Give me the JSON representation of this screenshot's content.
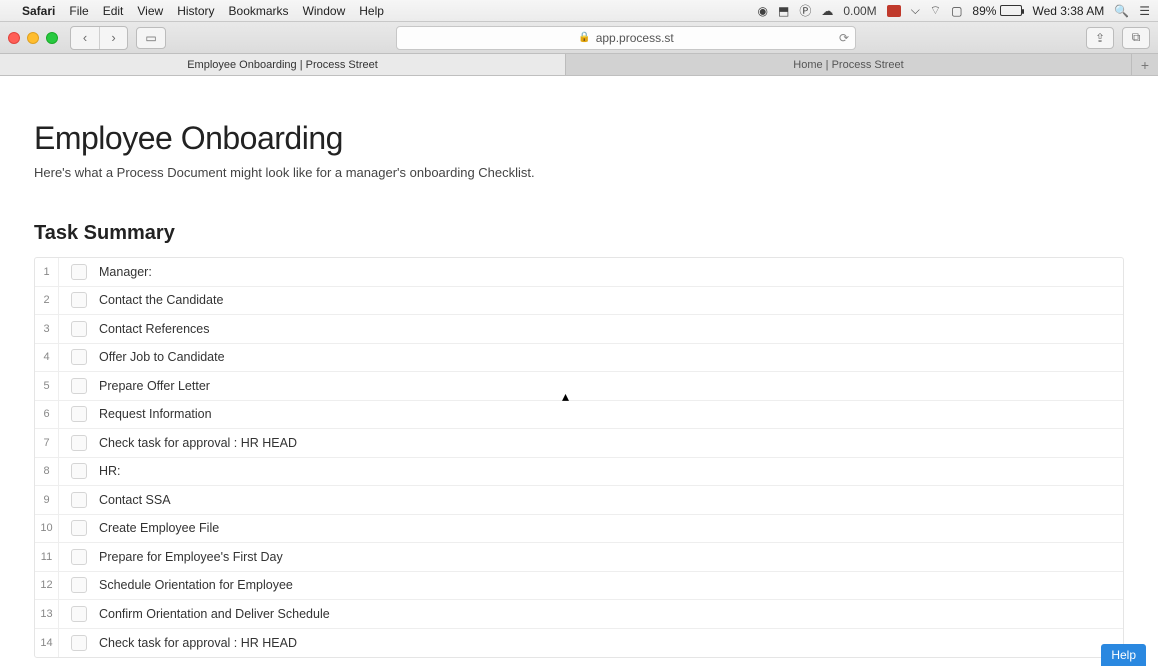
{
  "menubar": {
    "apple": "",
    "app": "Safari",
    "items": [
      "File",
      "Edit",
      "View",
      "History",
      "Bookmarks",
      "Window",
      "Help"
    ],
    "status_text": "0.00M",
    "battery_pct": "89%",
    "clock": "Wed 3:38 AM"
  },
  "toolbar": {
    "back": "‹",
    "forward": "›",
    "sidebar": "▭",
    "url": "app.process.st",
    "reload": "⟳",
    "share": "⇪",
    "tabs_icon": "⧉"
  },
  "tabs": [
    {
      "label": "Employee Onboarding | Process Street",
      "active": true
    },
    {
      "label": "Home | Process Street",
      "active": false
    }
  ],
  "tabs_add": "+",
  "page": {
    "title": "Employee Onboarding",
    "subtitle": "Here's what a Process Document might look like for a manager's onboarding Checklist.",
    "section_title": "Task Summary"
  },
  "tasks": [
    {
      "n": "1",
      "label": "Manager:"
    },
    {
      "n": "2",
      "label": "Contact the Candidate"
    },
    {
      "n": "3",
      "label": "Contact References"
    },
    {
      "n": "4",
      "label": "Offer Job to Candidate"
    },
    {
      "n": "5",
      "label": "Prepare Offer Letter"
    },
    {
      "n": "6",
      "label": "Request Information"
    },
    {
      "n": "7",
      "label": "Check task for approval : HR HEAD"
    },
    {
      "n": "8",
      "label": "HR:"
    },
    {
      "n": "9",
      "label": "Contact SSA"
    },
    {
      "n": "10",
      "label": "Create Employee File"
    },
    {
      "n": "11",
      "label": "Prepare for Employee's First Day"
    },
    {
      "n": "12",
      "label": "Schedule Orientation for Employee"
    },
    {
      "n": "13",
      "label": "Confirm Orientation and Deliver Schedule"
    },
    {
      "n": "14",
      "label": "Check task for approval : HR HEAD"
    }
  ],
  "help": "Help"
}
